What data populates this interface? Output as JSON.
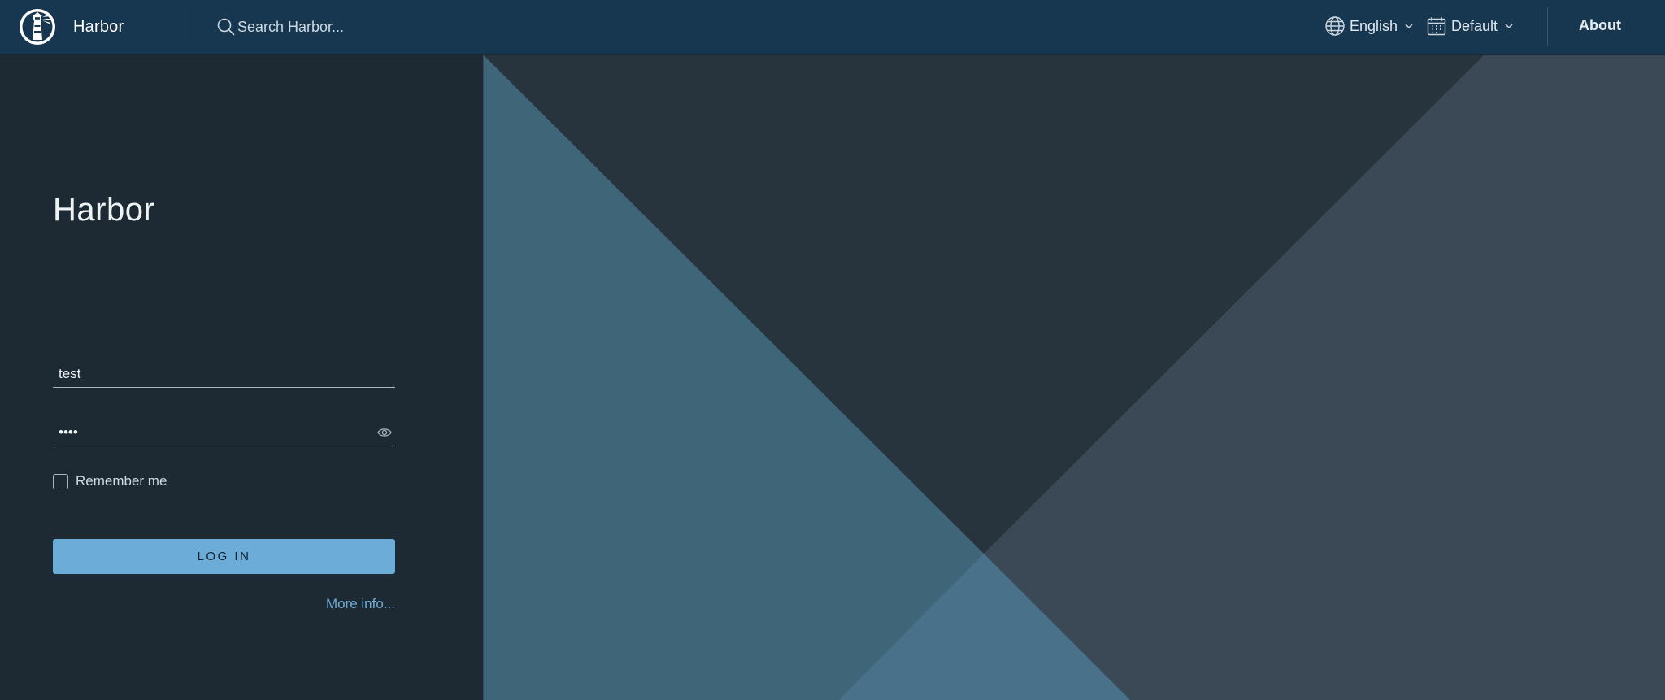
{
  "header": {
    "app_name": "Harbor",
    "search_placeholder": "Search Harbor...",
    "language_label": "English",
    "theme_label": "Default",
    "about_label": "About",
    "icons": {
      "logo": "harbor-lighthouse-logo-icon",
      "search": "search-icon",
      "language": "globe-icon",
      "theme": "calendar-icon",
      "chevron": "chevron-down-icon"
    }
  },
  "login": {
    "title": "Harbor",
    "username_value": "test",
    "password_value": "test",
    "remember_label": "Remember me",
    "remember_checked": false,
    "login_button": "LOG IN",
    "more_info": "More info...",
    "show_password_icon": "eye-icon"
  },
  "colors": {
    "header_bg": "#17364f",
    "panel_bg": "#1e2a33",
    "accent": "#6badd8",
    "art_dark": "#27343e",
    "art_blue": "#3f6579",
    "art_slate": "#3a4955",
    "art_light_blue": "#4a718a"
  }
}
